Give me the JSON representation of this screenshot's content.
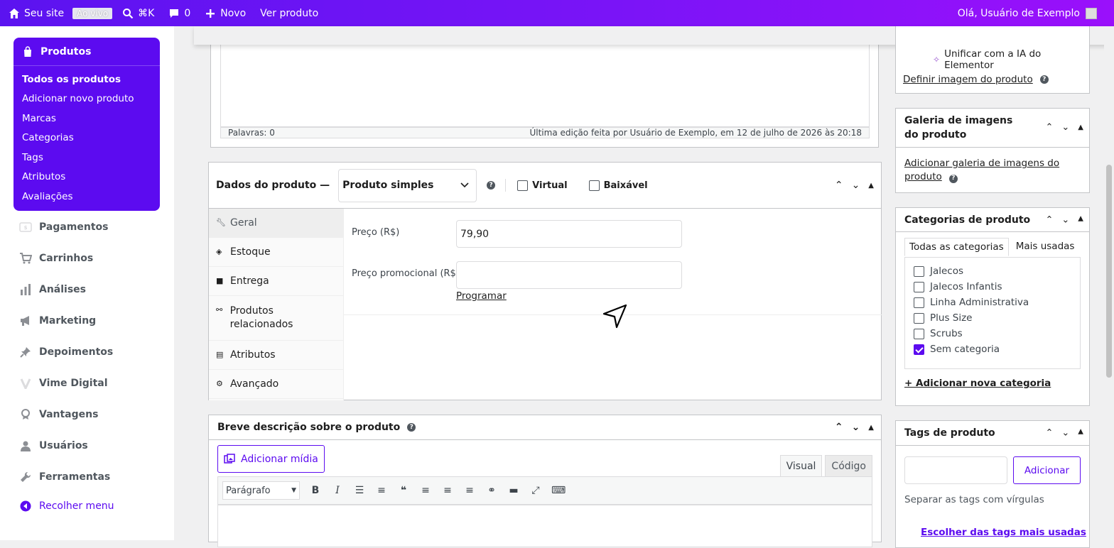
{
  "adminbar": {
    "site_name": "Seu site",
    "live_badge": "Ao vivo",
    "search_shortcut": "⌘K",
    "comments_count": "0",
    "new_label": "Novo",
    "view_product": "Ver produto",
    "greeting": "Olá, Usuário de Exemplo"
  },
  "sidebar": {
    "products_title": "Produtos",
    "submenu": [
      "Todos os produtos",
      "Adicionar novo produto",
      "Marcas",
      "Categorias",
      "Tags",
      "Atributos",
      "Avaliações"
    ],
    "menu": [
      "Pagamentos",
      "Carrinhos",
      "Análises",
      "Marketing",
      "Depoimentos",
      "Vime Digital",
      "Vantagens",
      "Usuários",
      "Ferramentas"
    ],
    "collapse": "Recolher menu"
  },
  "editor": {
    "words": "Palavras: 0",
    "last_edit": "Última edição feita por Usuário de Exemplo, em 12 de julho de 2026 às 20:18"
  },
  "product_data": {
    "title": "Dados do produto —",
    "type": "Produto simples",
    "virtual_label": "Virtual",
    "download_label": "Baixável",
    "tabs": [
      "Geral",
      "Estoque",
      "Entrega",
      "Produtos relacionados",
      "Atributos",
      "Avançado"
    ],
    "price_label": "Preço (R$)",
    "price_value": "79,90",
    "promo_label": "Preço promocional (R$)",
    "promo_value": "",
    "schedule_link": "Programar"
  },
  "short_desc": {
    "title": "Breve descrição sobre o produto",
    "add_media": "Adicionar mídia",
    "tab_visual": "Visual",
    "tab_code": "Código",
    "format": "Parágrafo"
  },
  "product_image": {
    "ai_link": "Unificar com a IA do Elementor",
    "set_image": "Definir imagem do produto"
  },
  "gallery": {
    "title_line1": "Galeria de imagens",
    "title_line2": "do produto",
    "add_link": "Adicionar galeria de imagens do produto"
  },
  "categories": {
    "title": "Categorias de produto",
    "tab_all": "Todas as categorias",
    "tab_most": "Mais usadas",
    "items": [
      {
        "label": "Jalecos",
        "checked": false
      },
      {
        "label": "Jalecos Infantis",
        "checked": false
      },
      {
        "label": "Linha Administrativa",
        "checked": false
      },
      {
        "label": "Plus Size",
        "checked": false
      },
      {
        "label": "Scrubs",
        "checked": false
      },
      {
        "label": "Sem categoria",
        "checked": true
      }
    ],
    "add_new": "+ Adicionar nova categoria"
  },
  "tags": {
    "title": "Tags de produto",
    "input_value": "",
    "add_button": "Adicionar",
    "hint": "Separar as tags com vírgulas",
    "choose_link": "Escolher das tags mais usadas"
  },
  "colors": {
    "accent": "#5c0bf0",
    "adminbar_start": "#5b13f0",
    "adminbar_end": "#9a10fb"
  }
}
